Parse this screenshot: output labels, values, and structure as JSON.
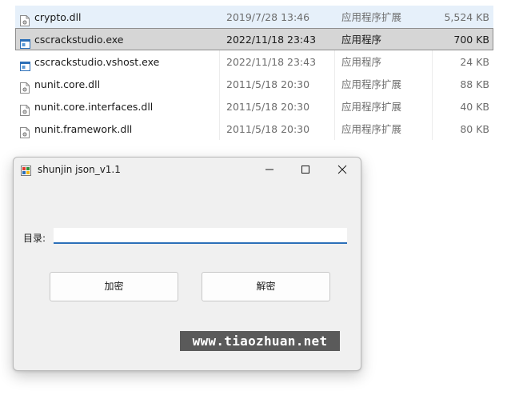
{
  "files": [
    {
      "name": "crypto.dll",
      "date": "2019/7/28 13:46",
      "type": "应用程序扩展",
      "size": "5,524 KB",
      "icon": "dll-file-icon",
      "state": "hover"
    },
    {
      "name": "cscrackstudio.exe",
      "date": "2022/11/18 23:43",
      "type": "应用程序",
      "size": "700 KB",
      "icon": "exe-file-icon",
      "state": "selected"
    },
    {
      "name": "cscrackstudio.vshost.exe",
      "date": "2022/11/18 23:43",
      "type": "应用程序",
      "size": "24 KB",
      "icon": "exe-file-icon",
      "state": "normal"
    },
    {
      "name": "nunit.core.dll",
      "date": "2011/5/18 20:30",
      "type": "应用程序扩展",
      "size": "88 KB",
      "icon": "dll-file-icon",
      "state": "normal"
    },
    {
      "name": "nunit.core.interfaces.dll",
      "date": "2011/5/18 20:30",
      "type": "应用程序扩展",
      "size": "40 KB",
      "icon": "dll-file-icon",
      "state": "normal"
    },
    {
      "name": "nunit.framework.dll",
      "date": "2011/5/18 20:30",
      "type": "应用程序扩展",
      "size": "80 KB",
      "icon": "dll-file-icon",
      "state": "normal"
    }
  ],
  "dialog": {
    "title": "shunjin json_v1.1",
    "app_icon": "app-window-icon",
    "directory_label": "目录:",
    "directory_value": "",
    "encrypt_label": "加密",
    "decrypt_label": "解密"
  },
  "watermark": "www.tiaozhuan.net",
  "colors": {
    "accent": "#2b6fb8",
    "selected_row": "#d6d6d6",
    "hover_row": "#e6f0fa",
    "dialog_bg": "#f0f0f0",
    "watermark_bg": "#5a5a5a"
  }
}
